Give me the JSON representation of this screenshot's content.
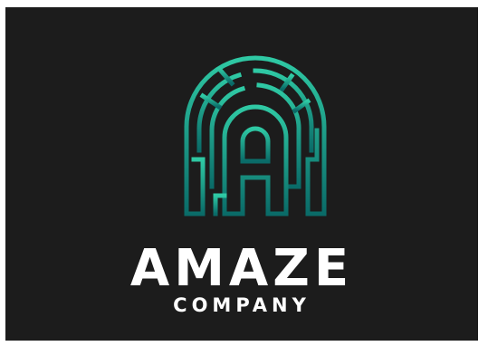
{
  "brand": {
    "name": "AMAZE",
    "tagline": "COMPANY"
  },
  "colors": {
    "background": "#1c1c1c",
    "text": "#ffffff",
    "gradient_light": "#2fc9a4",
    "gradient_dark": "#0a6b68"
  },
  "logo": {
    "icon": "maze-arch-letter-a-icon"
  }
}
